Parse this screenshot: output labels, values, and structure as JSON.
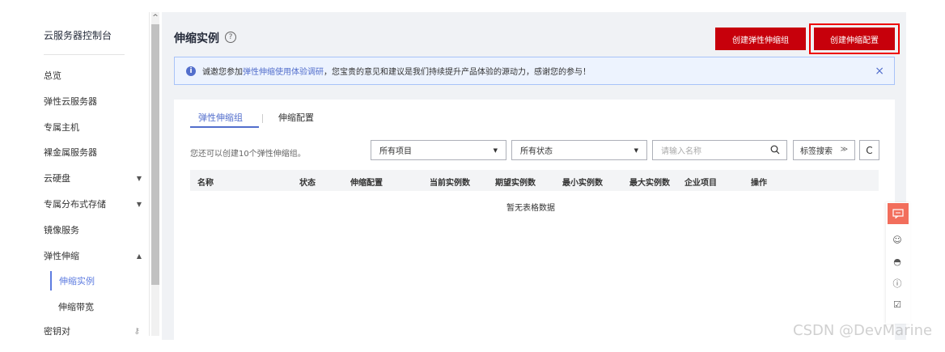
{
  "sidebar": {
    "title": "云服务器控制台",
    "items": [
      {
        "label": "总览"
      },
      {
        "label": "弹性云服务器"
      },
      {
        "label": "专属主机"
      },
      {
        "label": "裸金属服务器"
      },
      {
        "label": "云硬盘"
      },
      {
        "label": "专属分布式存储"
      },
      {
        "label": "镜像服务"
      },
      {
        "label": "弹性伸缩"
      }
    ],
    "sub_items": [
      {
        "label": "伸缩实例"
      },
      {
        "label": "伸缩带宽"
      }
    ],
    "last_item": "密钥对"
  },
  "header": {
    "title": "伸缩实例",
    "help": "?",
    "btn_create_group": "创建弹性伸缩组",
    "btn_create_config": "创建伸缩配置"
  },
  "notice": {
    "prefix": "诚邀您参加",
    "link": "弹性伸缩使用体验调研",
    "suffix": "，您宝贵的意见和建议是我们持续提升产品体验的源动力，感谢您的参与！",
    "close": "×",
    "info": "i"
  },
  "tabs": [
    {
      "label": "弹性伸缩组"
    },
    {
      "label": "伸缩配置"
    }
  ],
  "filters": {
    "hint": "您还可以创建10个弹性伸缩组。",
    "project": "所有项目",
    "status": "所有状态",
    "search_placeholder": "请输入名称",
    "tag_search": "标签搜索",
    "tag_caret": "≫",
    "refresh": "C"
  },
  "table": {
    "columns": [
      "名称",
      "状态",
      "伸缩配置",
      "当前实例数",
      "期望实例数",
      "最小实例数",
      "最大实例数",
      "企业项目",
      "操作"
    ],
    "empty_text": "暂无表格数据"
  },
  "watermark": "CSDN @DevMarine",
  "colors": {
    "brand_red": "#c7000b",
    "accent_blue": "#526ecc"
  }
}
